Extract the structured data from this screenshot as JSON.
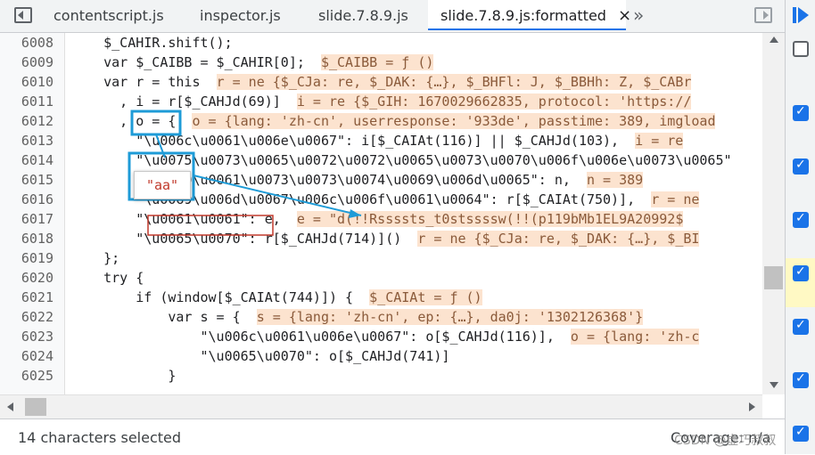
{
  "tabs": [
    {
      "label": "contentscript.js",
      "active": false
    },
    {
      "label": "inspector.js",
      "active": false
    },
    {
      "label": "slide.7.8.9.js",
      "active": false
    },
    {
      "label": "slide.7.8.9.js:formatted",
      "active": true
    }
  ],
  "toolbar": {
    "close_glyph": "×",
    "more_glyph": "»"
  },
  "lines": [
    {
      "n": "6008",
      "code": "    $_CAHIR.shift();",
      "hint": ""
    },
    {
      "n": "6009",
      "code": "    var $_CAIBB = $_CAHIR[0];",
      "hint": "$_CAIBB = ƒ ()"
    },
    {
      "n": "6010",
      "code": "    var r = this",
      "hint": "r = ne {$_CJa: re, $_DAK: {…}, $_BHFl: J, $_BBHh: Z, $_CABr"
    },
    {
      "n": "6011",
      "code": "      , i = r[$_CAHJd(69)]",
      "hint": "i = re {$_GIH: 1670029662835, protocol: 'https://"
    },
    {
      "n": "6012",
      "code": "      , o = {",
      "hint": "o = {lang: 'zh-cn', userresponse: '933de', passtime: 389, imgload"
    },
    {
      "n": "6013",
      "code": "        \"\\u006c\\u0061\\u006e\\u0067\": i[$_CAIAt(116)] || $_CAHJd(103),",
      "hint": "i = re"
    },
    {
      "n": "6014",
      "code": "        \"\\u0075\\u0073\\u0065\\u0072\\u0072\\u0065\\u0073\\u0070\\u006f\\u006e\\u0073\\u0065\"",
      "hint": ""
    },
    {
      "n": "6015",
      "code": "        \"\\u0070\\u0061\\u0073\\u0073\\u0074\\u0069\\u006d\\u0065\": n,",
      "hint": "n = 389"
    },
    {
      "n": "6016",
      "code": "        \"\\u0069\\u006d\\u0067\\u006c\\u006f\\u0061\\u0064\": r[$_CAIAt(750)],",
      "hint": "r = ne"
    },
    {
      "n": "6017",
      "code": "        \"\\u0061\\u0061\": e,",
      "hint": "e = \"d(!!Rssssts_t0stssssw(!!(p119bMb1EL9A20992$"
    },
    {
      "n": "6018",
      "code": "        \"\\u0065\\u0070\": r[$_CAHJd(714)]()",
      "hint": "r = ne {$_CJa: re, $_DAK: {…}, $_BI"
    },
    {
      "n": "6019",
      "code": "    };",
      "hint": ""
    },
    {
      "n": "6020",
      "code": "    try {",
      "hint": ""
    },
    {
      "n": "6021",
      "code": "        if (window[$_CAIAt(744)]) {",
      "hint": "$_CAIAt = ƒ ()"
    },
    {
      "n": "6022",
      "code": "            var s = {",
      "hint": "s = {lang: 'zh-cn', ep: {…}, da0j: '1302126368'}"
    },
    {
      "n": "6023",
      "code": "                \"\\u006c\\u0061\\u006e\\u0067\": o[$_CAHJd(116)],",
      "hint": "o = {lang: 'zh-c"
    },
    {
      "n": "6024",
      "code": "                \"\\u0065\\u0070\": o[$_CAHJd(741)]",
      "hint": ""
    },
    {
      "n": "6025",
      "code": "            }",
      "hint": ""
    }
  ],
  "callout": {
    "label": "\"aa\""
  },
  "status": {
    "selection": "14 characters selected",
    "coverage": "Coverage: n/a",
    "watermark": "CSDN @虚巧叔叔"
  },
  "colors": {
    "highlight": "#1e9bd7",
    "tab_active": "#1a73e8"
  }
}
